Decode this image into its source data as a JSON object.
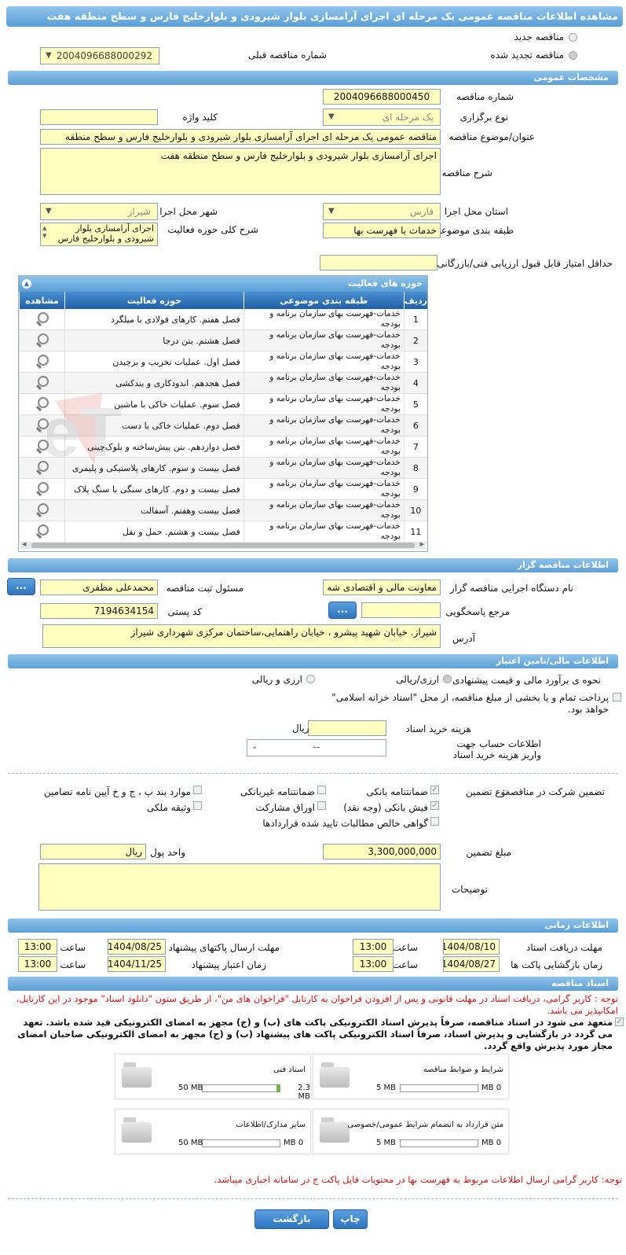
{
  "page_title": "مشاهده اطلاعات مناقصه عمومی یک مرحله ای اجرای آرامسازی بلوار شیرودی و بلوارخلیج فارس و سطح منطقه هفت",
  "top": {
    "new_tender": "مناقصه جدید",
    "renewed_tender": "مناقصه تجدید شده",
    "prev_label": "شماره مناقصه قبلی",
    "prev_value": "2004096688000292"
  },
  "general": {
    "header": "مشخصات عمومی",
    "number_label": "شماره مناقصه",
    "number": "2004096688000450",
    "type_label": "نوع برگزاری",
    "type": "یک مرحله ای",
    "keyword_label": "کلید واژه",
    "subject_label": "عنوان/موضوع مناقصه",
    "subject": "مناقصه عمومی یک مرحله ای اجرای آرامسازی بلوار شیرودی و بلوارخلیج فارس و سطح منطقه",
    "desc_label": "شرح مناقصه",
    "desc": "اجرای آرامسازی بلوار شیرودی و بلوارخلیج فارس و سطح منطقه هفت",
    "province_label": "استان محل اجرا",
    "province": "فارس",
    "city_label": "شهر محل اجرا",
    "city": "شیراز",
    "class_label": "طبقه بندی موضوعی",
    "class": "خدمات با فهرست بها",
    "activity_desc_label": "شرح کلی حوزه فعالیت",
    "activity_desc": "اجرای آرامسازی بلوار شیرودی و بلوارخلیج فارس",
    "min_score_label": "حداقل امتیاز قابل قبول ارزیابی فنی/بازرگانی"
  },
  "grid": {
    "title": "حوزه های فعالیت",
    "col_row": "ردیف",
    "col_class": "طبقه بندی موضوعی",
    "col_area": "حوزه فعالیت",
    "col_view": "مشاهده",
    "rows": [
      {
        "n": "1",
        "c": "خدمات-فهرست بهای سازمان برنامه و بودجه",
        "a": "فصل هفتم. کارهای فولادی با میلگرد"
      },
      {
        "n": "2",
        "c": "خدمات-فهرست بهای سازمان برنامه و بودجه",
        "a": "فصل هشتم. بتن درجا"
      },
      {
        "n": "3",
        "c": "خدمات-فهرست بهای سازمان برنامه و بودجه",
        "a": "فصل اول. عملیات تخریب و برچیدن"
      },
      {
        "n": "4",
        "c": "خدمات-فهرست بهای سازمان برنامه و بودجه",
        "a": "فصل هجدهم. اندودکاری و بندکشی"
      },
      {
        "n": "5",
        "c": "خدمات-فهرست بهای سازمان برنامه و بودجه",
        "a": "فصل سوم. عملیات خاکی با ماشین"
      },
      {
        "n": "6",
        "c": "خدمات-فهرست بهای سازمان برنامه و بودجه",
        "a": "فصل دوم. عملیات خاکی با دست"
      },
      {
        "n": "7",
        "c": "خدمات-فهرست بهای سازمان برنامه و بودجه",
        "a": "فصل دوازدهم. بتن پیش‌ساخته و بلوک‌چینی"
      },
      {
        "n": "8",
        "c": "خدمات-فهرست بهای سازمان برنامه و بودجه",
        "a": "فصل بیست و سوم. کارهای پلاستیکی و پلیمری"
      },
      {
        "n": "9",
        "c": "خدمات-فهرست بهای سازمان برنامه و بودجه",
        "a": "فصل بیست و دوم. کارهای سنگی با سنگ پلاک"
      },
      {
        "n": "10",
        "c": "خدمات-فهرست بهای سازمان برنامه و بودجه",
        "a": "فصل بیست وهفتم. آسفالت"
      },
      {
        "n": "11",
        "c": "خدمات-فهرست بهای سازمان برنامه و بودجه",
        "a": "فصل بیست و هشتم. حمل و نقل"
      }
    ]
  },
  "organizer": {
    "header": "اطلاعات مناقصه گزار",
    "org_label": "نام دستگاه اجرایی مناقصه گزار",
    "org": "معاونت مالی و اقتصادی شه",
    "reg_label": "مسئول ثبت مناقصه",
    "reg": "محمدعلی مظفری",
    "ref_label": "مرجع پاسخگویی",
    "postal_label": "کد پستی",
    "postal": "7194634154",
    "address_label": "آدرس",
    "address": "شیراز. خیابان شهید پیشرو ، خیابان راهنمایی،ساختمان مرکزی شهرداری شیراز",
    "dots": "..."
  },
  "finance": {
    "header": "اطلاعات مالی/تامین اعتبار",
    "estimate_label": "نحوه ی برآورد مالی و قیمت پیشنهادی",
    "rial": "ارزی/ریالی",
    "fx": "ارزی و ریالی",
    "treasury": "پرداخت تمام و یا بخشی از مبلغ مناقصه، از محل \"اسناد خزانه اسلامی\" خواهد بود.",
    "doc_cost_label": "هزینه خرید اسناد",
    "doc_cost_unit": "ریال",
    "account_label": "اطلاعات حساب جهت واریز هزینه خرید اسناد",
    "account_value": "--"
  },
  "guarantee": {
    "label": "تضمین شرکت در مناقصه:",
    "type_label": "نوع تضمین",
    "o1": "ضمانتنامه بانکی",
    "o2": "ضمانتنامه غیربانکی",
    "o3": "موارد بند پ ، ج و خ آیین نامه تضامین",
    "o4": "فیش بانکی (وجه نقد)",
    "o5": "اوراق مشارکت",
    "o6": "وثیقه ملکی",
    "o7": "گواهی خالص مطالبات تایید شده قراردادها",
    "amount_label": "مبلغ تضمین",
    "amount": "3,300,000,000",
    "unit_label": "واحد پول",
    "unit": "ریال",
    "notes_label": "توضیحات"
  },
  "timing": {
    "header": "اطلاعات زمانی",
    "doc_deadline_label": "مهلت دریافت اسناد",
    "doc_deadline": "1404/08/10",
    "send_deadline_label": "مهلت ارسال پاکتهای پیشنهاد",
    "send_deadline": "1404/08/25",
    "open_label": "زمان بازگشایی پاکت ها",
    "open": "1404/08/27",
    "valid_label": "زمان اعتبار پیشنهاد",
    "valid": "1404/11/25",
    "time_label": "ساعت",
    "t1": "13:00",
    "t2": "13:00",
    "t3": "13:00",
    "t4": "13:00"
  },
  "docs": {
    "header": "اسناد مناقصه",
    "note1": "توجه : کاربر گرامی، دریافت اسناد در مهلت قانونی و پس از افزودن فراخوان به کارتابل \"فراخوان های من\"، از طریق ستون \"دانلود اسناد\" موجود در این کارتابل، امکانپذیر می باشد.",
    "commit": "متعهد می شود در اسناد مناقصه، صرفاً پذیرش اسناد الکترونیکی پاکت های (ب) و (ج) مجهز به امضای الکترونیکی قید شده باشد. تعهد می گردد در بازگشایی و پذیرش اسناد، صرفاً اسناد الکترونیکی پاکت های پیشنهاد (ب) و (ج) مجهز به امضای الکترونیکی صاحبان امضای مجاز مورد پذیرش واقع گردد.",
    "f1_name": "شرایط و ضوابط مناقصه",
    "f1_size": "0 MB",
    "f1_max": "5 MB",
    "f2_name": "اسناد فنی",
    "f2_size": "2.3 MB",
    "f2_max": "50 MB",
    "f3_name": "متن قرارداد به انضمام شرایط عمومی/خصوصی",
    "f3_size": "0 MB",
    "f3_max": "5 MB",
    "f4_name": "سایر مدارک/اطلاعات",
    "f4_size": "0 MB",
    "f4_max": "50 MB",
    "note2": "توجه: کاربر گرامی ارسال اطلاعات مربوط به فهرست بها در محتویات فایل پاکت ج در سامانه اجباری میباشد."
  },
  "buttons": {
    "print": "چاپ",
    "back": "بازگشت"
  },
  "watermark": "AriaTender.neT"
}
